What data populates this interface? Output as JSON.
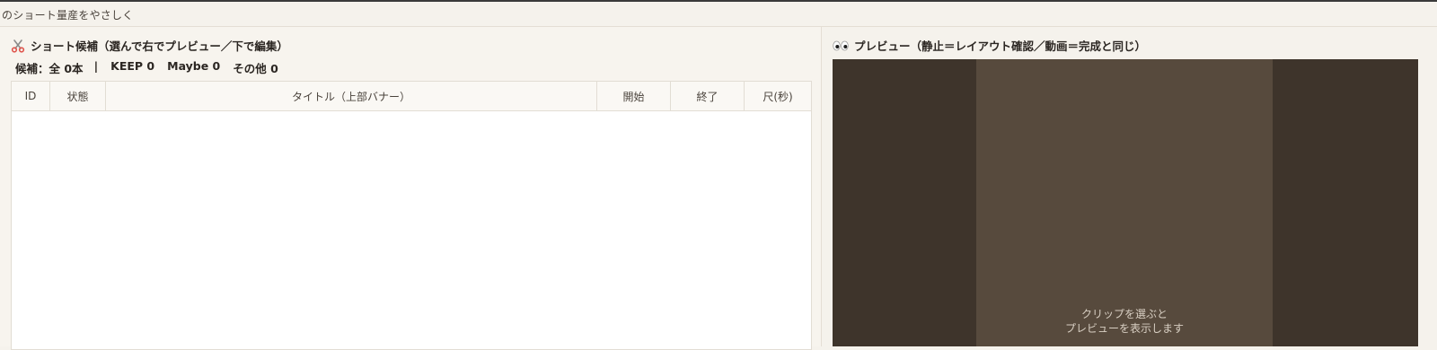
{
  "app": {
    "title": "のショート量産をやさしく"
  },
  "candidates": {
    "heading": "ショート候補（選んで右でプレビュー／下で編集）",
    "summary": {
      "total": "候補：全 0本",
      "separator": "|",
      "keep": "KEEP 0",
      "maybe": "Maybe 0",
      "other": "その他 0"
    },
    "columns": [
      "ID",
      "状態",
      "タイトル（上部バナー）",
      "開始",
      "終了",
      "尺(秒)"
    ],
    "rows": []
  },
  "preview": {
    "heading": "プレビュー（静止＝レイアウト確認／動画＝完成と同じ）",
    "message_line1": "クリップを選ぶと",
    "message_line2": "プレビューを表示します"
  },
  "icons": {
    "candidates": "scissors-icon",
    "preview": "eyes-icon"
  },
  "colors": {
    "background": "#f5f2ec",
    "preview_outer": "#3e342b",
    "preview_frame": "#574a3d"
  }
}
